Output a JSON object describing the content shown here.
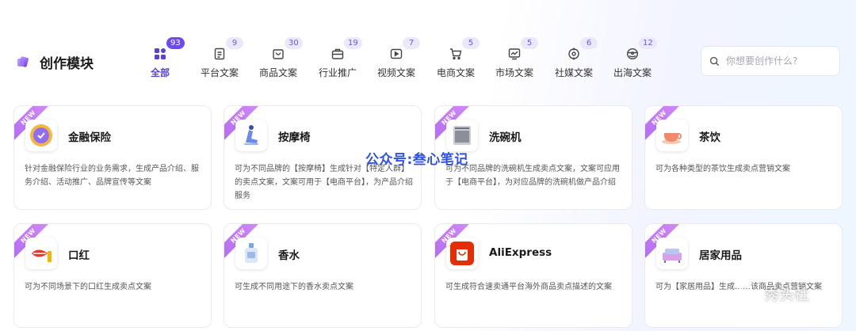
{
  "header": {
    "module_title": "创作模块",
    "search_placeholder": "你想要创作什么?"
  },
  "tabs": [
    {
      "label": "全部",
      "count": "93",
      "icon": "grid-icon",
      "active": true
    },
    {
      "label": "平台文案",
      "count": "9",
      "icon": "document-icon"
    },
    {
      "label": "商品文案",
      "count": "30",
      "icon": "shopping-bag-icon"
    },
    {
      "label": "行业推广",
      "count": "19",
      "icon": "briefcase-icon"
    },
    {
      "label": "视频文案",
      "count": "7",
      "icon": "video-icon"
    },
    {
      "label": "电商文案",
      "count": "5",
      "icon": "cart-icon"
    },
    {
      "label": "市场文案",
      "count": "5",
      "icon": "chart-icon"
    },
    {
      "label": "社媒文案",
      "count": "6",
      "icon": "social-icon"
    },
    {
      "label": "出海文案",
      "count": "12",
      "icon": "globe-icon"
    }
  ],
  "cards": [
    {
      "title": "金融保险",
      "badge": "NEW",
      "desc": "针对金融保险行业的业务需求，生成产品介绍、服务介绍、活动推广、品牌宣传等文案",
      "icon": "finance-insurance-icon"
    },
    {
      "title": "按摩椅",
      "badge": "NEW",
      "desc": "可为不同品牌的【按摩椅】生成针对【特定人群】的卖点文案，文案可用于【电商平台】，为产品介绍服务",
      "icon": "massage-chair-icon"
    },
    {
      "title": "洗碗机",
      "badge": "NEW",
      "desc": "可为不同品牌的洗碗机生成卖点文案，文案可应用于【电商平台】，为对应品牌的洗碗机做产品介绍",
      "icon": "dishwasher-icon"
    },
    {
      "title": "茶饮",
      "badge": "NEW",
      "desc": "可为各种类型的茶饮生成卖点营销文案",
      "icon": "tea-cup-icon"
    },
    {
      "title": "口红",
      "badge": "NEW",
      "desc": "可为不同场景下的口红生成卖点文案",
      "icon": "lipstick-icon"
    },
    {
      "title": "香水",
      "badge": "NEW",
      "desc": "可生成不同用途下的香水卖点文案",
      "icon": "perfume-icon"
    },
    {
      "title": "AliExpress",
      "badge": "NEW",
      "desc": "可生成符合速卖通平台海外商品卖点描述的文案",
      "icon": "aliexpress-icon"
    },
    {
      "title": "居家用品",
      "badge": "NEW",
      "desc": "可为【家居用品】生成……该商品卖点营销文案",
      "icon": "home-goods-icon"
    }
  ],
  "watermarks": {
    "center": "公众号:叁心笔记",
    "corner": "秀头社"
  },
  "colors": {
    "accent": "#6e4bf0",
    "badge_bg": "#ebe8fb",
    "ribbon": "#c27cf5",
    "watermark_blue": "#2f52e8"
  }
}
